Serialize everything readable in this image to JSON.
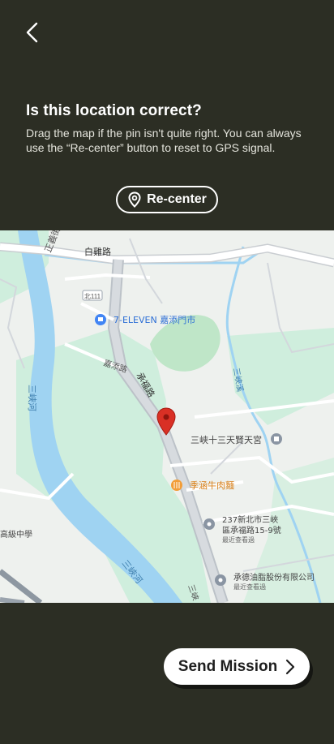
{
  "header": {
    "back_icon": "chevron-left-icon",
    "title": "Is this location correct?",
    "description": "Drag the map if the pin isn't quite right. You can always use the “Re-center” button to reset to GPS signal."
  },
  "recenter": {
    "label": "Re-center",
    "icon": "location-pin-icon"
  },
  "map": {
    "labels": {
      "road_top_left": "正義街",
      "road_baili": "白雞路",
      "route_shield": "北111",
      "seven_eleven": "7-ELEVEN 嘉添門市",
      "road_jiatian": "嘉添路",
      "road_chengfu": "承福路",
      "temple": "三峽十三天賢天宮",
      "restaurant": "季涵牛肉麵",
      "address_line1": "237新北市三峽",
      "address_line2": "區承福路15-9號",
      "address_sub": "最近查看過",
      "company": "承德油脂股份有限公司",
      "company_sub": "最近查看過",
      "school": "高級中學",
      "river_left": "三峽河",
      "river_bottom": "三峽河",
      "creek": "三峽溪",
      "road_bottom": "三峽"
    },
    "colors": {
      "pin": "#d93025",
      "water": "#9fd3f2",
      "park": "#bfe6c8",
      "land": "#eef1ee",
      "road": "#ffffff",
      "poi_blue": "#4285f4",
      "poi_orange": "#f29d38",
      "poi_gray": "#8a95a3"
    }
  },
  "send_mission": {
    "label": "Send Mission",
    "icon": "chevron-right-icon"
  }
}
